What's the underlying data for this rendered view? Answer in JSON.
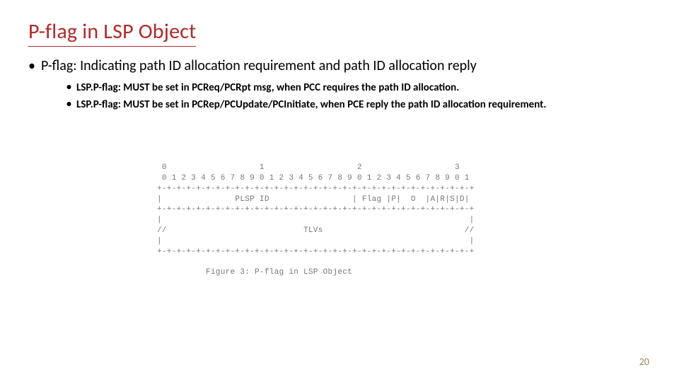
{
  "title": "P-flag in LSP Object",
  "bullet1": "P-flag: Indicating path ID allocation requirement and path ID allocation reply",
  "sub1": "LSP.P-flag:  MUST be set in PCReq/PCRpt msg, when PCC requires the path ID allocation.",
  "sub2": "LSP.P-flag:  MUST be set in PCRep/PCUpdate/PCInitiate, when PCE reply the path ID allocation requirement.",
  "figure": {
    "header_nums": " 0                   1                   2                   3",
    "bit_nums": " 0 1 2 3 4 5 6 7 8 9 0 1 2 3 4 5 6 7 8 9 0 1 2 3 4 5 6 7 8 9 0 1",
    "divider": "+-+-+-+-+-+-+-+-+-+-+-+-+-+-+-+-+-+-+-+-+-+-+-+-+-+-+-+-+-+-+-+-+",
    "row1": "|               PLSP ID                 | Flag |P|  O  |A|R|S|D|",
    "row_tlv_l": "|                                                               |",
    "row_tlv": "//                            TLVs                             //",
    "row_tlv_r": "|                                                               |",
    "open_div": "+-+-+-+-+-+-+-+-+-+-+-+-+-+-+-+-+-+-+-+-+-+-+-+-+-+-+-+-+-+-+-+-+",
    "caption": "Figure 3: P-flag in LSP Object"
  },
  "page_number": "20"
}
